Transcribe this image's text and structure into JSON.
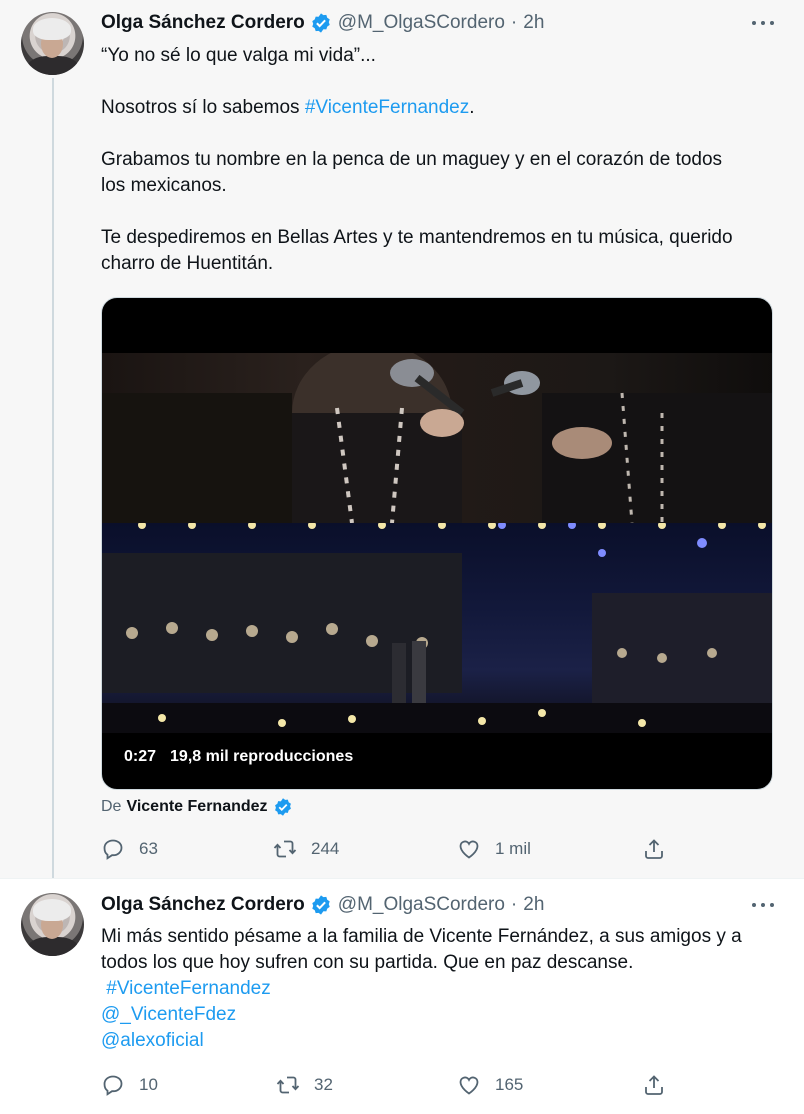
{
  "tweets": [
    {
      "author": {
        "name": "Olga Sánchez Cordero",
        "handle": "@M_OlgaSCordero",
        "time": "2h"
      },
      "lines": [
        {
          "text": "“Yo no sé lo que valga mi vida”..."
        },
        {
          "text": ""
        },
        {
          "pre": "Nosotros sí lo sabemos ",
          "hashtag": "#VicenteFernandez",
          "post": "."
        },
        {
          "text": ""
        },
        {
          "text": "Grabamos tu nombre en la penca de un maguey y en el corazón de todos"
        },
        {
          "text": "los mexicanos."
        },
        {
          "text": ""
        },
        {
          "text": "Te despediremos en Bellas Artes y te mantendremos en tu música, querido"
        },
        {
          "text": "charro de Huentitán."
        }
      ],
      "video": {
        "duration": "0:27",
        "views": "19,8 mil reproducciones"
      },
      "from": {
        "prefix": "De",
        "name": "Vicente Fernandez"
      },
      "stats": {
        "replies": "63",
        "retweets": "244",
        "likes": "1 mil"
      }
    },
    {
      "author": {
        "name": "Olga Sánchez Cordero",
        "handle": "@M_OlgaSCordero",
        "time": "2h"
      },
      "lines": [
        {
          "text": "Mi más sentido pésame a la familia de Vicente Fernández, a sus amigos y a"
        },
        {
          "text": "todos los que hoy sufren con su partida. Que en paz descanse."
        },
        {
          "hashtag": " #VicenteFernandez"
        },
        {
          "hashtag": "@_VicenteFdez"
        },
        {
          "hashtag": "@alexoficial"
        }
      ],
      "stats": {
        "replies": "10",
        "retweets": "32",
        "likes": "165"
      }
    }
  ],
  "colors": {
    "link": "#1d9bf0",
    "verified": "#1d9bf0",
    "muted": "#536471"
  },
  "icons": [
    "more-icon",
    "verified-icon",
    "reply-icon",
    "retweet-icon",
    "like-icon",
    "share-icon"
  ]
}
